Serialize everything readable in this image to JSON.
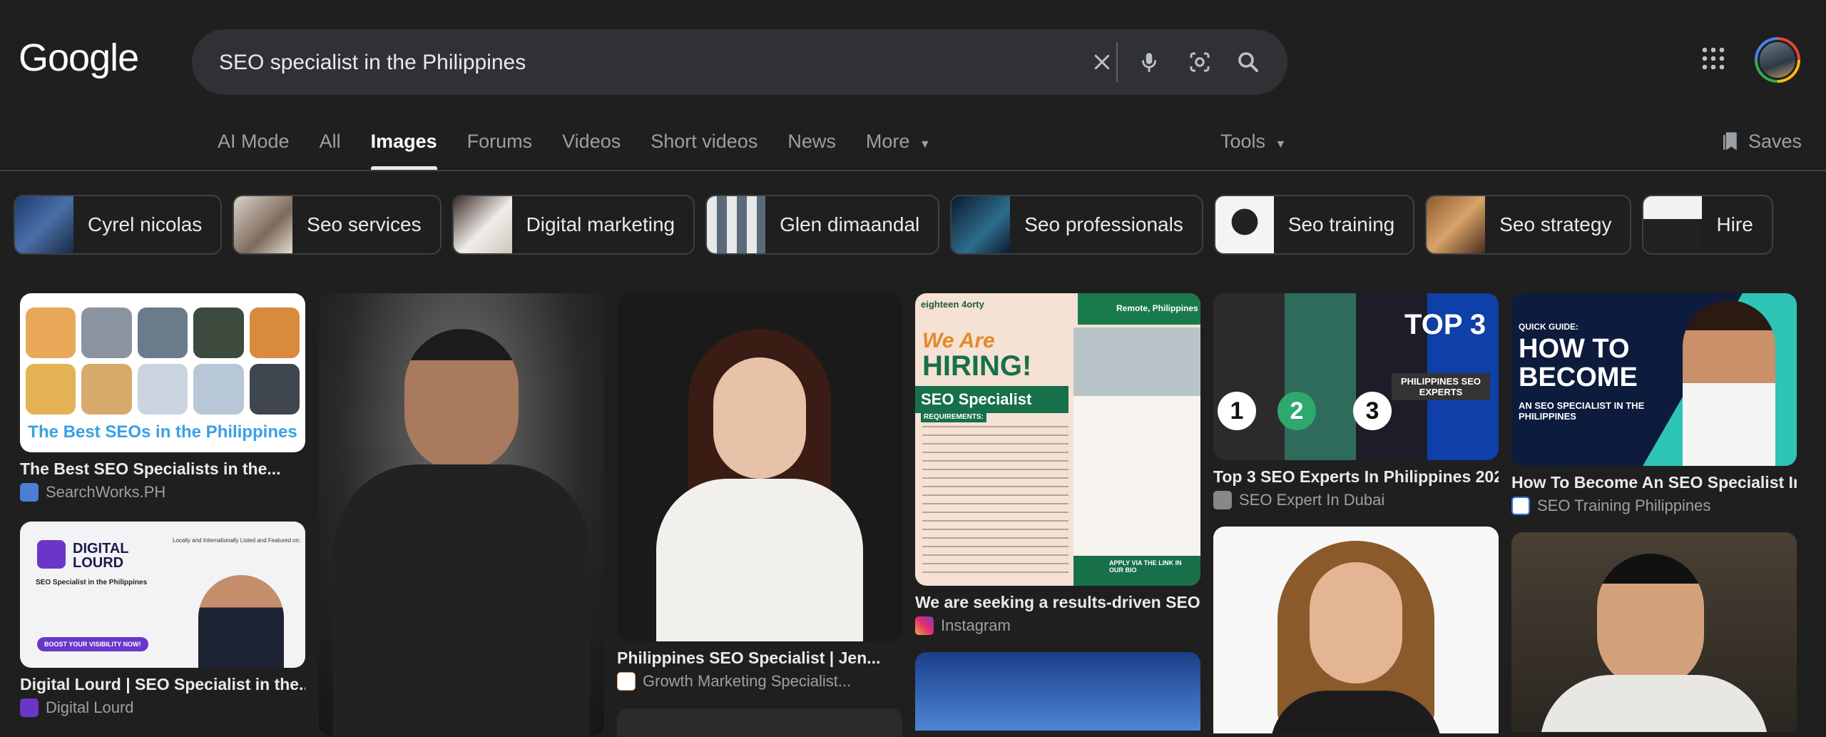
{
  "header": {
    "logo": "Google",
    "search_value": "SEO specialist in the Philippines"
  },
  "tabs": [
    "AI Mode",
    "All",
    "Images",
    "Forums",
    "Videos",
    "Short videos",
    "News",
    "More"
  ],
  "tools_label": "Tools",
  "saves_label": "Saves",
  "chips": [
    "Cyrel nicolas",
    "Seo services",
    "Digital marketing",
    "Glen dimaandal",
    "Seo professionals",
    "Seo training",
    "Seo strategy",
    "Hire"
  ],
  "results": [
    {
      "title": "The Best SEO Specialists in the...",
      "source": "SearchWorks.PH",
      "overlay": "The Best SEOs in the Philippines"
    },
    {
      "title": "Digital Lourd | SEO Specialist in the...",
      "source": "Digital Lourd",
      "overlay_brand": "DIGITAL LOURD",
      "overlay_sub": "SEO Specialist in the Philippines",
      "overlay_featured": "Locally and Internationally Listed and Featured on:",
      "overlay_cta": "BOOST YOUR VISIBILITY NOW!"
    },
    {
      "title": "Philippines SEO Specialist | Jen...",
      "source": "Growth Marketing Specialist..."
    },
    {
      "title": "We are seeking a results-driven SEO...",
      "source": "Instagram",
      "overlay_brand": "eighteen 4orty",
      "overlay_hiring1": "We Are",
      "overlay_hiring2": "HIRING!",
      "overlay_role": "SEO Specialist",
      "overlay_req": "REQUIREMENTS:",
      "overlay_loc": "Remote, Philippines",
      "overlay_apply": "APPLY VIA THE LINK IN OUR BIO"
    },
    {
      "title": "Top 3 SEO Experts In Philippines 202...",
      "source": "SEO Expert In Dubai",
      "overlay_top": "TOP 3",
      "overlay_sub": "PHILIPPINES SEO EXPERTS"
    },
    {
      "title": "How To Become An SEO Specialist In...",
      "source": "SEO Training Philippines",
      "overlay_quick": "QUICK GUIDE:",
      "overlay_how": "HOW TO BECOME",
      "overlay_sub": "AN SEO SPECIALIST IN THE PHILIPPINES"
    }
  ],
  "colors": {
    "background": "#1f1f1f",
    "searchbox": "#303134",
    "text": "#e8eaed",
    "muted": "#9aa0a6"
  }
}
